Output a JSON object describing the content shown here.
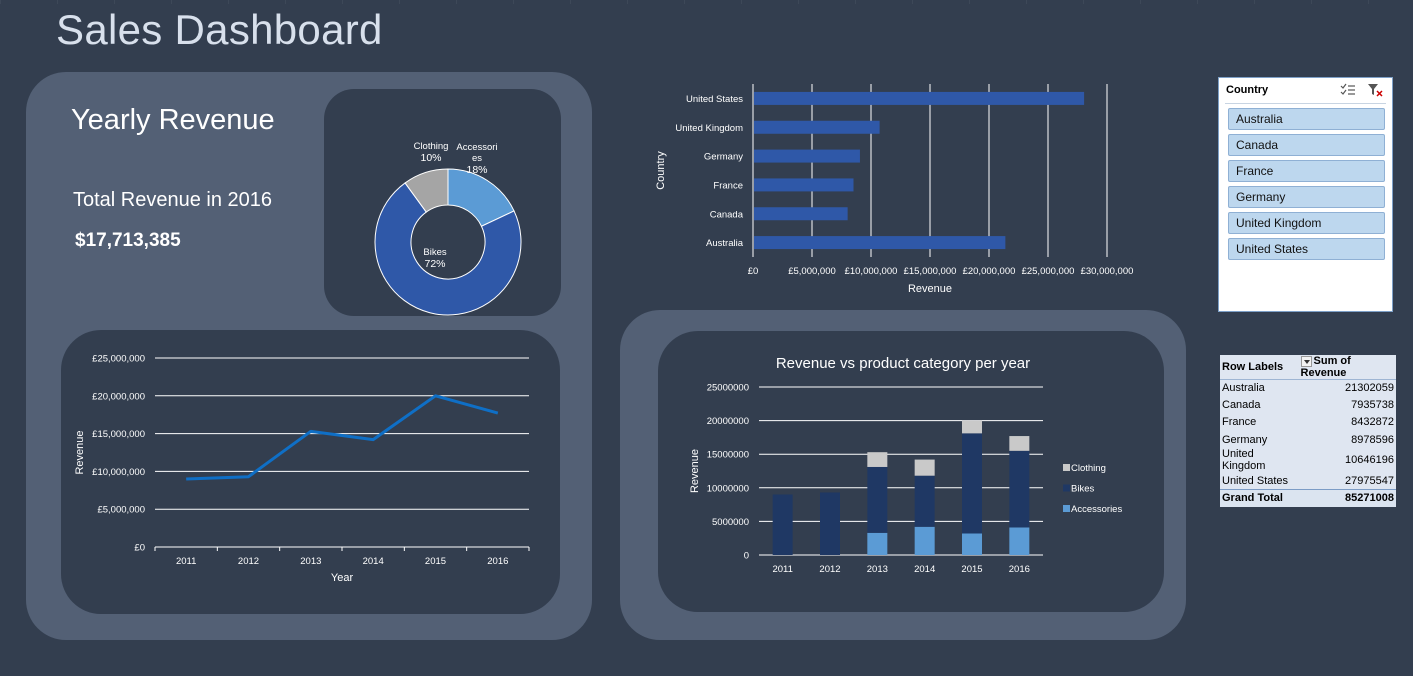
{
  "page": {
    "title": "Sales Dashboard"
  },
  "yearly": {
    "heading": "Yearly Revenue",
    "total_label": "Total Revenue in 2016",
    "total_value": "$17,713,385"
  },
  "slicer": {
    "header": "Country",
    "items": [
      "Australia",
      "Canada",
      "France",
      "Germany",
      "United Kingdom",
      "United States"
    ]
  },
  "pivot": {
    "col_row_labels": "Row Labels",
    "col_sum": "Sum of Revenue",
    "rows": [
      {
        "label": "Australia",
        "value": "21302059"
      },
      {
        "label": "Canada",
        "value": "7935738"
      },
      {
        "label": "France",
        "value": "8432872"
      },
      {
        "label": "Germany",
        "value": "8978596"
      },
      {
        "label": "United Kingdom",
        "value": "10646196"
      },
      {
        "label": "United States",
        "value": "27975547"
      }
    ],
    "total_label": "Grand Total",
    "total_value": "85271008"
  },
  "colors": {
    "bikes": "#2f58a8",
    "accessories": "#5b9bd5",
    "clothing": "#a5a5a5",
    "bar": "#2f58a8",
    "line": "#0f6fc6",
    "stack_bikes": "#1f3864",
    "stack_accessories": "#5b9bd5",
    "stack_clothing": "#c9c9c9"
  },
  "chart_data": [
    {
      "id": "donut",
      "type": "pie",
      "categories": [
        "Bikes",
        "Accessories",
        "Clothing"
      ],
      "labels": [
        "Bikes",
        "Accessori\nes",
        "Clothing"
      ],
      "values": [
        72,
        18,
        10
      ],
      "value_labels": [
        "72%",
        "18%",
        "10%"
      ]
    },
    {
      "id": "country_bar",
      "type": "bar",
      "orientation": "horizontal",
      "categories": [
        "United States",
        "United Kingdom",
        "Germany",
        "France",
        "Canada",
        "Australia"
      ],
      "values": [
        27975547,
        10646196,
        8978596,
        8432872,
        7935738,
        21302059
      ],
      "xlabel": "Revenue",
      "ylabel": "Country",
      "xlim": [
        0,
        30000000
      ],
      "tick_labels": [
        "£0",
        "£5,000,000",
        "£10,000,000",
        "£15,000,000",
        "£20,000,000",
        "£25,000,000",
        "£30,000,000"
      ],
      "grid": true
    },
    {
      "id": "yearly_line",
      "type": "line",
      "categories": [
        "2011",
        "2012",
        "2013",
        "2014",
        "2015",
        "2016"
      ],
      "values": [
        9000000,
        9300000,
        15300000,
        14200000,
        20000000,
        17713385
      ],
      "xlabel": "Year",
      "ylabel": "Revenue",
      "ylim": [
        0,
        25000000
      ],
      "tick_labels": [
        "£0",
        "£5,000,000",
        "£10,000,000",
        "£15,000,000",
        "£20,000,000",
        "£25,000,000"
      ],
      "grid": true
    },
    {
      "id": "stacked",
      "type": "bar",
      "stacked": true,
      "title": "Revenue vs product category per year",
      "categories": [
        "2011",
        "2012",
        "2013",
        "2014",
        "2015",
        "2016"
      ],
      "series": [
        {
          "name": "Accessories",
          "values": [
            0,
            0,
            3300000,
            4200000,
            3200000,
            4100000
          ]
        },
        {
          "name": "Bikes",
          "values": [
            9000000,
            9300000,
            9800000,
            7600000,
            14900000,
            11400000
          ]
        },
        {
          "name": "Clothing",
          "values": [
            0,
            0,
            2200000,
            2400000,
            1900000,
            2200000
          ]
        }
      ],
      "legend_order": [
        "Clothing",
        "Bikes",
        "Accessories"
      ],
      "ylabel": "Revenue",
      "ylim": [
        0,
        25000000
      ],
      "tick_labels": [
        "0",
        "5000000",
        "10000000",
        "15000000",
        "20000000",
        "25000000"
      ],
      "legend": "right",
      "grid": true
    }
  ]
}
